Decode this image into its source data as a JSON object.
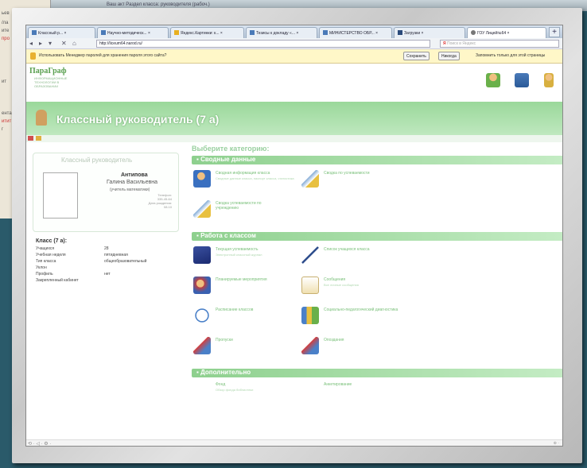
{
  "background": {
    "paper_lines": [
      "ьев",
      "/ла",
      "ите",
      "про",
      "ит",
      "ента",
      "итит",
      "г"
    ],
    "top_strip_text": "Ваш акт Раздел класса: руководителя (рабоч.)"
  },
  "browser": {
    "tabs": [
      {
        "label": "Классный р... ×"
      },
      {
        "label": "Научно-методическ... ×"
      },
      {
        "label": "Яндекс.Картинки: к... ×"
      },
      {
        "label": "Тезисы к докладу «... ×"
      },
      {
        "label": "МИНИСТЕРСТВО ОБР... ×"
      },
      {
        "label": "Загрузки ×"
      },
      {
        "label": "ГОУ Лицей№64 ×"
      }
    ],
    "new_tab": "+",
    "nav": {
      "back": "◂",
      "forward": "▸",
      "history": "▾",
      "stop": "✕",
      "home": "⌂"
    },
    "url": "http://liceum64.narod.ru/",
    "search_placeholder": "Поиск в Яндекс",
    "search_engine_letter": "Я"
  },
  "infobar": {
    "message": "Использовать Менеджер паролей для хранения пароля этого сайта?",
    "save_label": "Сохранить",
    "never_label": "Никогда",
    "remember_text": "Запомнить только для этой страницы"
  },
  "site": {
    "logo": "ПараГраф",
    "logo_sub": "ИНФОРМАЦИОННЫЕ ТЕХНОЛОГИИ В ОБРАЗОВАНИИ",
    "page_title": "Классный руководитель (7 а)",
    "profile": {
      "header": "Классный руководитель",
      "surname": "Антипова",
      "name": "Галина Васильевна",
      "role": "(учитель математики)",
      "phone_label": "Телефон:",
      "phone": "335-45-64",
      "birth_label": "Дата рождения:",
      "birth": "08.10"
    },
    "class_info": {
      "title": "Класс (7 а):",
      "rows": [
        {
          "k": "Учащихся",
          "v": "28"
        },
        {
          "k": "Учебная неделя",
          "v": "пятидневная"
        },
        {
          "k": "Тип класса",
          "v": "общеобразовательный"
        },
        {
          "k": "Уклон",
          "v": ""
        },
        {
          "k": "Профиль",
          "v": "нет"
        },
        {
          "k": "Закрепленный кабинет",
          "v": ""
        }
      ]
    },
    "choose_category": "Выберите категорию:",
    "sections": [
      {
        "title": "Сводные данные"
      },
      {
        "title": "Работа с классом"
      },
      {
        "title": "Дополнительно"
      }
    ],
    "categories_summary": [
      {
        "title": "Сводная информация класса",
        "sub": "Сводные данные класса, паспорт класса, статистика"
      },
      {
        "title": "Сводка по успеваемости",
        "sub": ""
      },
      {
        "title": "Сводка успеваемости по учреждению",
        "sub": ""
      }
    ],
    "categories_work": [
      {
        "title": "Текущая успеваемость",
        "sub": "Электронный классный журнал"
      },
      {
        "title": "Список учащихся класса",
        "sub": ""
      },
      {
        "title": "Планируемые мероприятия",
        "sub": ""
      },
      {
        "title": "Сообщения",
        "sub": "Все личные сообщения"
      },
      {
        "title": "Расписание классов",
        "sub": ""
      },
      {
        "title": "Социально-педагогический диагностика",
        "sub": ""
      },
      {
        "title": "Пропуски",
        "sub": ""
      },
      {
        "title": "Опоздания",
        "sub": ""
      }
    ],
    "categories_extra": [
      {
        "title": "Фонд",
        "sub": "Обзор фонда библиотеки"
      },
      {
        "title": "Анкетирование",
        "sub": ""
      }
    ]
  },
  "statusbar": {
    "left": "⟲ · ◁ · ⚙ ·",
    "right": "⊕ ·"
  }
}
